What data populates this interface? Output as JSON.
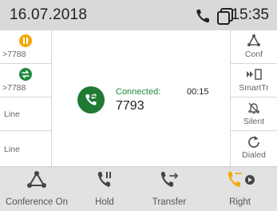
{
  "status": {
    "date": "16.07.2018",
    "time": "15:35",
    "icons": [
      "phone-icon",
      "copy-icon"
    ]
  },
  "left_keys": [
    {
      "label": ">7788",
      "icon": "pause-icon",
      "color": "#f2a900"
    },
    {
      "label": ">7788",
      "icon": "transfer-icon",
      "color": "#1f8a3a"
    },
    {
      "label": "Line"
    },
    {
      "label": "Line"
    }
  ],
  "right_keys": [
    {
      "label": "Conf",
      "icon": "conference-icon"
    },
    {
      "label": "SmartTr",
      "icon": "smart-transfer-icon"
    },
    {
      "label": "Silent",
      "icon": "bell-off-icon"
    },
    {
      "label": "Dialed",
      "icon": "redial-icon"
    }
  ],
  "call": {
    "status": "Connected:",
    "timer": "00:15",
    "number": "7793",
    "avatar_color": "#1f7a34"
  },
  "softkeys": [
    {
      "label": "Conference On",
      "icon": "conference-icon"
    },
    {
      "label": "Hold",
      "icon": "hold-icon"
    },
    {
      "label": "Transfer",
      "icon": "transfer-icon"
    },
    {
      "label": "Right",
      "icon": "call-record-icon",
      "accent": "#f2a900"
    }
  ]
}
